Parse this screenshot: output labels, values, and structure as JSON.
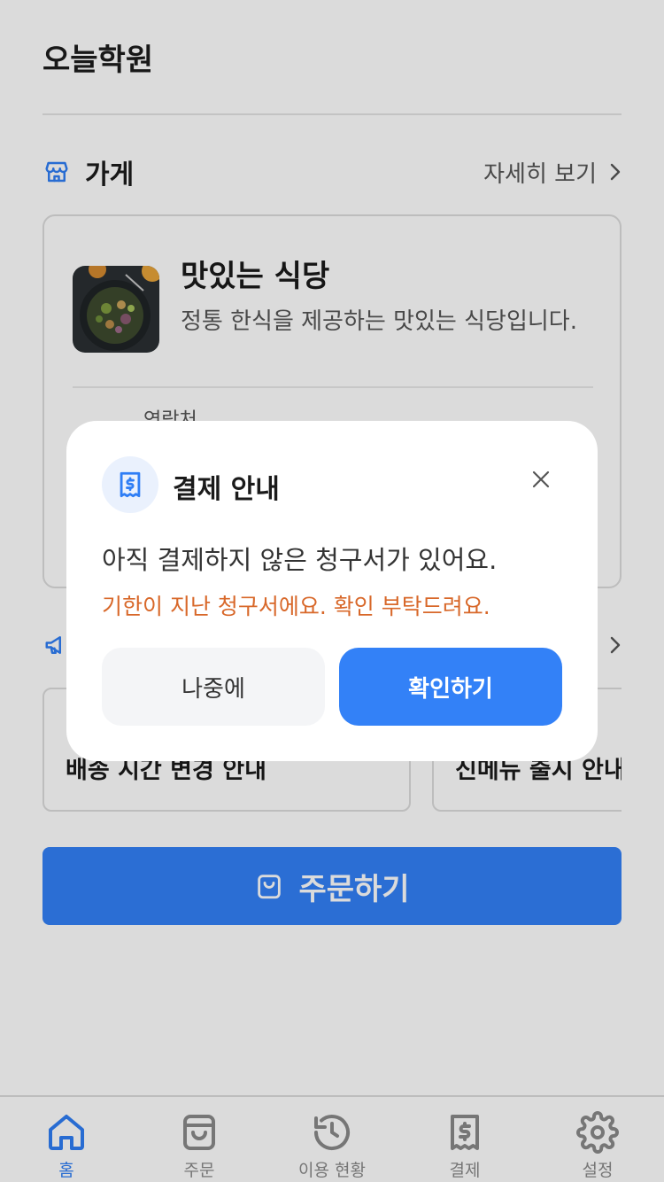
{
  "app": {
    "title": "오늘학원"
  },
  "store_section": {
    "title": "가게",
    "more_label": "자세히 보기"
  },
  "store": {
    "name": "맛있는 식당",
    "description": "정통 한식을 제공하는 맛있는 식당입니다.",
    "contact_label": "연락처"
  },
  "notices": [
    {
      "title": "배송 시간 변경 안내"
    },
    {
      "title": "신메뉴 출시 안내"
    }
  ],
  "order_button": {
    "label": "주문하기"
  },
  "tabbar": {
    "items": [
      {
        "label": "홈",
        "icon": "home-icon",
        "active": true
      },
      {
        "label": "주문",
        "icon": "shopping-bag-icon",
        "active": false
      },
      {
        "label": "이용 현황",
        "icon": "history-icon",
        "active": false
      },
      {
        "label": "결제",
        "icon": "receipt-icon",
        "active": false
      },
      {
        "label": "설정",
        "icon": "gear-icon",
        "active": false
      }
    ]
  },
  "modal": {
    "title": "결제 안내",
    "message": "아직 결제하지 않은 청구서가 있어요.",
    "warning": "기한이 지난 청구서에요. 확인 부탁드려요.",
    "later_label": "나중에",
    "confirm_label": "확인하기"
  },
  "colors": {
    "primary": "#3381f7",
    "warning": "#d8682a",
    "overlay": "rgba(0,0,0,0.14)"
  }
}
